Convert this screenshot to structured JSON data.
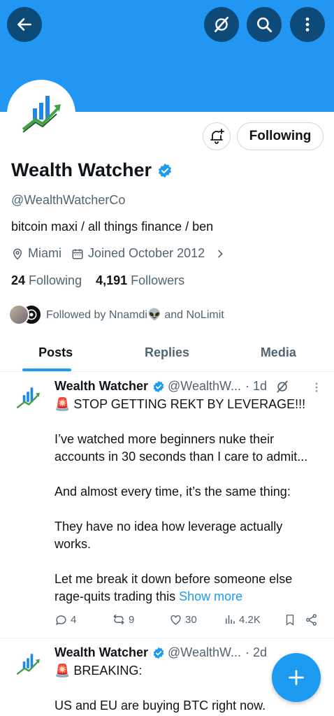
{
  "header": {
    "back_icon": "arrow-left-icon",
    "grok_icon": "grok-icon",
    "search_icon": "search-icon",
    "more_icon": "more-vertical-icon",
    "banner_color": "#2196f3"
  },
  "profile": {
    "name": "Wealth Watcher",
    "handle": "@WealthWatcherCo",
    "bio": "bitcoin maxi / all things finance / ben",
    "location": "Miami",
    "joined": "Joined October 2012",
    "following_count": "24",
    "following_label": "Following",
    "followers_count": "4,191",
    "followers_label": "Followers",
    "followed_by": "Followed by Nnamdi👽 and NoLimit",
    "follow_button_label": "Following",
    "verified_color": "#1d9bf0"
  },
  "tabs": [
    {
      "label": "Posts",
      "active": true
    },
    {
      "label": "Replies",
      "active": false
    },
    {
      "label": "Media",
      "active": false
    }
  ],
  "tweets": [
    {
      "name": "Wealth Watcher",
      "handle": "@WealthW...",
      "time": "· 1d",
      "lines": [
        "🚨 STOP GETTING REKT BY LEVERAGE!!!",
        "",
        "I’ve watched more beginners nuke their",
        "accounts in 30 seconds than I care to admit...",
        "",
        "And almost every time, it’s the same thing:",
        "",
        "They have no idea how leverage actually",
        "works.",
        "",
        "Let me break it down before someone else"
      ],
      "last_line": "rage-quits trading this",
      "show_more": "Show more",
      "replies": "4",
      "reposts": "9",
      "likes": "30",
      "views": "4.2K"
    },
    {
      "name": "Wealth Watcher",
      "handle": "@WealthW...",
      "time": "· 2d",
      "lines": [
        "🚨 BREAKING:",
        "",
        "US and EU are buying BTC right now."
      ]
    }
  ],
  "fab": {
    "icon": "plus-icon",
    "color": "#1d9bf0"
  }
}
